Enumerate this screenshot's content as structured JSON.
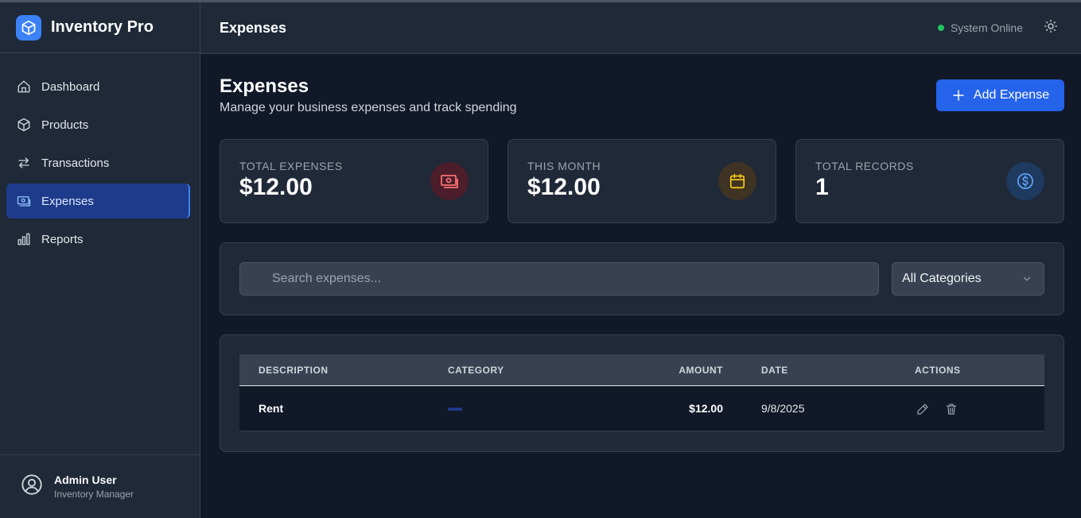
{
  "sidebar": {
    "brand": "Inventory Pro",
    "items": [
      {
        "label": "Dashboard",
        "icon": "home-icon"
      },
      {
        "label": "Products",
        "icon": "box-icon"
      },
      {
        "label": "Transactions",
        "icon": "arrows-icon"
      },
      {
        "label": "Expenses",
        "icon": "cash-icon",
        "active": true
      },
      {
        "label": "Reports",
        "icon": "bar-chart-icon"
      }
    ],
    "user": {
      "name": "Admin User",
      "role": "Inventory Manager"
    }
  },
  "header": {
    "title": "Expenses",
    "status": "System Online"
  },
  "main": {
    "title": "Expenses",
    "subtitle": "Manage your business expenses and track spending",
    "add_button": "Add Expense",
    "stats": [
      {
        "label": "TOTAL EXPENSES",
        "value": "$12.00",
        "icon": "cash-icon",
        "color": "#ef4444"
      },
      {
        "label": "THIS MONTH",
        "value": "$12.00",
        "icon": "calendar-icon",
        "color": "#eab308"
      },
      {
        "label": "TOTAL RECORDS",
        "value": "1",
        "icon": "dollar-icon",
        "color": "#3b82f6"
      }
    ],
    "search": {
      "placeholder": "Search expenses..."
    },
    "category_filter": {
      "selected": "All Categories"
    },
    "table": {
      "headers": [
        "DESCRIPTION",
        "CATEGORY",
        "AMOUNT",
        "DATE",
        "ACTIONS"
      ],
      "rows": [
        {
          "description": "Rent",
          "category": "",
          "amount": "$12.00",
          "date": "9/8/2025"
        }
      ]
    }
  },
  "colors": {
    "accent": "#2563eb",
    "background": "#111827",
    "surface": "#1f2937",
    "online": "#22c55e"
  }
}
